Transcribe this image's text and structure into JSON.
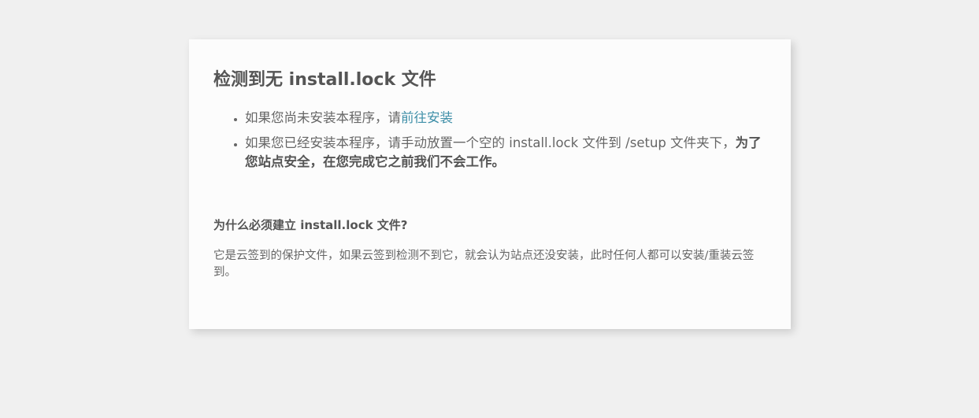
{
  "title": "检测到无 install.lock 文件",
  "items": [
    {
      "text": "如果您尚未安装本程序，请",
      "link": "前往安装"
    },
    {
      "text": "如果您已经安装本程序，请手动放置一个空的 install.lock 文件到 /setup 文件夹下，",
      "bold": "为了您站点安全，在您完成它之前我们不会工作。"
    }
  ],
  "why_heading": "为什么必须建立 install.lock 文件?",
  "why_text": "它是云签到的保护文件，如果云签到检测不到它，就会认为站点还没安装，此时任何人都可以安装/重装云签到。",
  "colors": {
    "link": "#3f8fa8",
    "background": "#f0f0f0",
    "card": "#fcfcfc"
  }
}
